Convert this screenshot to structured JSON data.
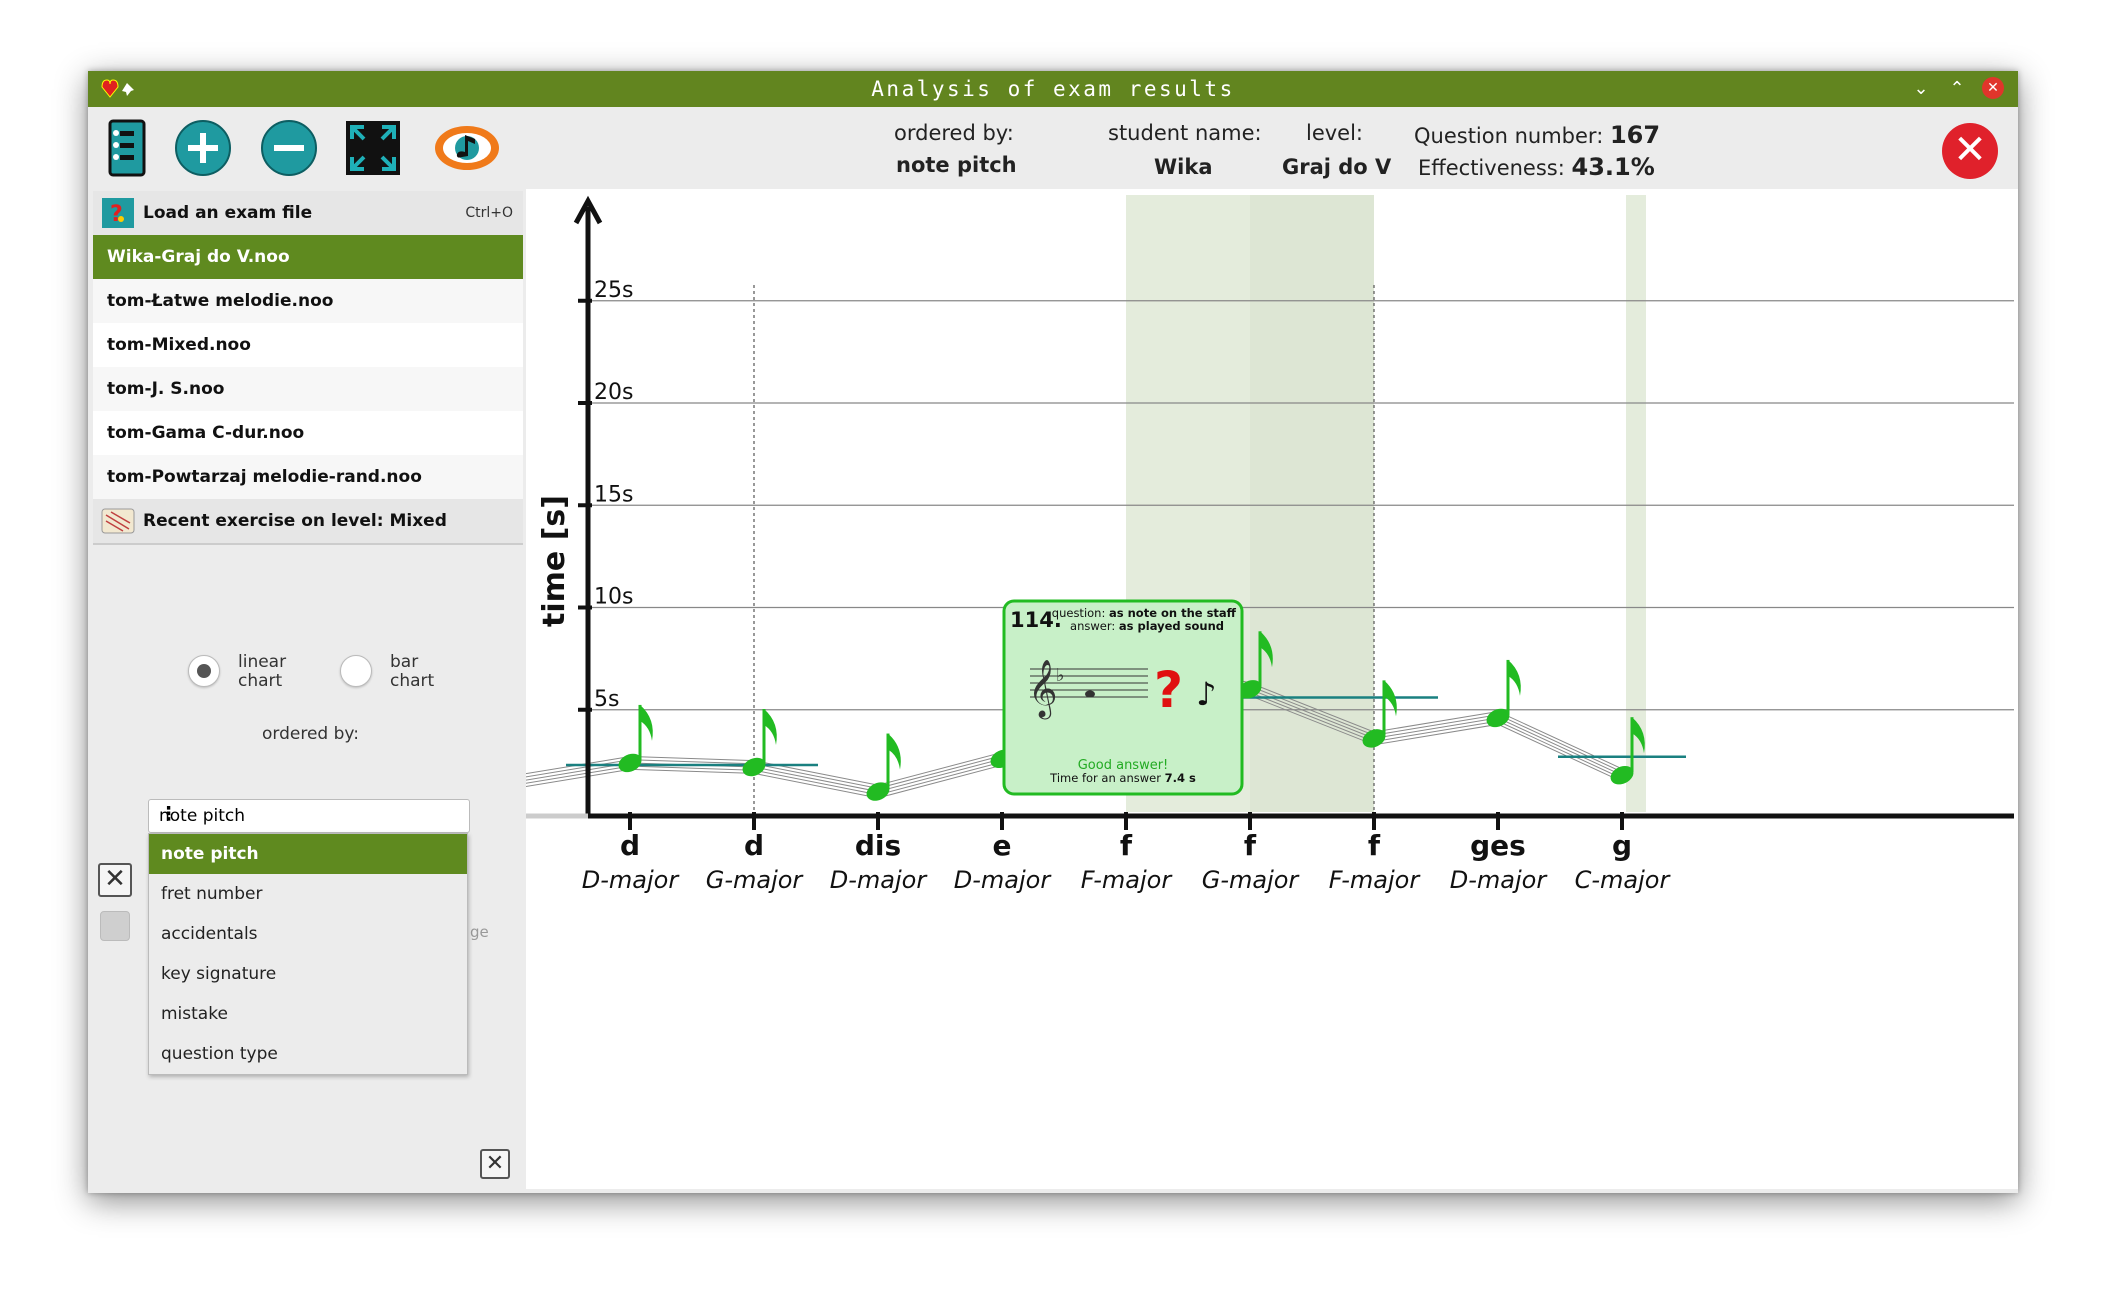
{
  "window": {
    "title": "Analysis of exam results"
  },
  "toolbar": {
    "ordered_by_label": "ordered by:",
    "ordered_by_value": "note pitch",
    "student_label": "student name:",
    "student_value": "Wika",
    "level_label": "level:",
    "level_value": "Graj do V",
    "question_number_label": "Question number:",
    "question_number_value": "167",
    "effectiveness_label": "Effectiveness:",
    "effectiveness_value": "43.1%"
  },
  "menu": {
    "load_label": "Load an exam file",
    "load_shortcut": "Ctrl+O",
    "files": [
      "Wika-Graj do V.noo",
      "tom-Łatwe melodie.noo",
      "tom-Mixed.noo",
      "tom-J. S.noo",
      "tom-Gama C-dur.noo",
      "tom-Powtarzaj melodie-rand.noo"
    ],
    "recent_label": "Recent exercise on level: Mixed"
  },
  "options": {
    "linear_label_1": "linear",
    "linear_label_2": "chart",
    "bar_label_1": "bar",
    "bar_label_2": "chart",
    "ordered_by_label": "ordered by:",
    "combo_value": "note pitch",
    "dropdown_items": [
      "note pitch",
      "fret number",
      "accidentals",
      "key signature",
      "mistake",
      "question type"
    ],
    "hidden_fragment": "ge"
  },
  "tooltip": {
    "number": "114.",
    "question_prefix": "question:",
    "question_value": "as note on the staff",
    "answer_prefix": "answer:",
    "answer_value": "as played sound",
    "result": "Good answer!",
    "time_prefix": "Time for an answer",
    "time_value": "7.4 s"
  },
  "chart_data": {
    "type": "line",
    "ylabel": "time [s]",
    "y_ticks": [
      "5s",
      "10s",
      "15s",
      "20s",
      "25s"
    ],
    "ylim": [
      0,
      30
    ],
    "categories": [
      {
        "note": "d",
        "key": "D-major"
      },
      {
        "note": "d",
        "key": "G-major"
      },
      {
        "note": "dis",
        "key": "D-major"
      },
      {
        "note": "e",
        "key": "D-major"
      },
      {
        "note": "f",
        "key": "F-major"
      },
      {
        "note": "f",
        "key": "G-major"
      },
      {
        "note": "f",
        "key": "F-major"
      },
      {
        "note": "ges",
        "key": "D-major"
      },
      {
        "note": "g",
        "key": "C-major"
      }
    ],
    "values": [
      2.4,
      2.2,
      1.0,
      2.6,
      7.4,
      6.0,
      3.6,
      4.6,
      1.8
    ],
    "averages": [
      {
        "from": 0,
        "to": 1,
        "value": 2.3
      },
      {
        "from": 4,
        "to": 6,
        "value": 5.6
      },
      {
        "from": 8,
        "to": 8,
        "value": 2.7
      }
    ],
    "highlight_range": [
      4,
      6
    ],
    "colors": {
      "note": "#22bb22",
      "average": "#1a8080",
      "highlight": "#e4ecdc",
      "accent": "#62851f"
    }
  }
}
